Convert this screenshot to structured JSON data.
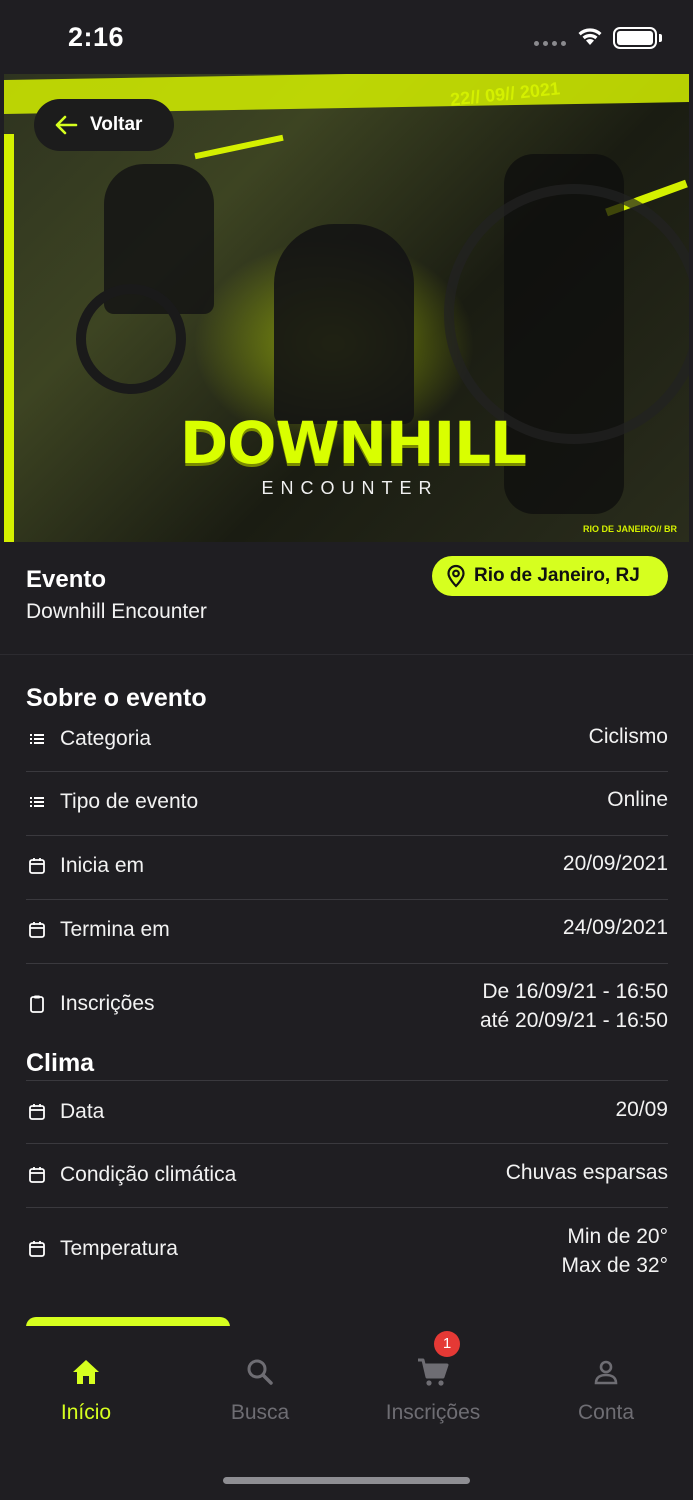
{
  "status_bar": {
    "time": "2:16"
  },
  "banner": {
    "back_label": "Voltar",
    "art_date": "22// 09// 2021",
    "art_title": "DOWNHILL",
    "art_subtitle": "ENCOUNTER",
    "art_location": "RIO DE JANEIRO// BR"
  },
  "event": {
    "heading": "Evento",
    "name": "Downhill Encounter",
    "location": "Rio de Janeiro, RJ"
  },
  "about": {
    "title": "Sobre o evento",
    "rows": [
      {
        "label": "Categoria",
        "icon": "list-icon",
        "value": "Ciclismo"
      },
      {
        "label": "Tipo de evento",
        "icon": "list-icon",
        "value": "Online"
      },
      {
        "label": "Inicia em",
        "icon": "calendar-icon",
        "value": "20/09/2021"
      },
      {
        "label": "Termina em",
        "icon": "calendar-icon",
        "value": "24/09/2021"
      },
      {
        "label": "Inscrições",
        "icon": "clipboard-icon",
        "value_line1": "De 16/09/21 - 16:50",
        "value_line2": "até 20/09/21 - 16:50"
      }
    ]
  },
  "weather": {
    "title": "Clima",
    "rows": [
      {
        "label": "Data",
        "icon": "calendar-icon",
        "value": "20/09"
      },
      {
        "label": "Condição climática",
        "icon": "calendar-icon",
        "value": "Chuvas esparsas"
      },
      {
        "label": "Temperatura",
        "icon": "calendar-icon",
        "value_line1": "Min de 20°",
        "value_line2": "Max de 32°"
      }
    ]
  },
  "tabbar": {
    "tabs": [
      {
        "label": "Início",
        "icon": "home-icon",
        "active": true
      },
      {
        "label": "Busca",
        "icon": "search-icon",
        "active": false
      },
      {
        "label": "Inscrições",
        "icon": "cart-icon",
        "active": false,
        "badge": "1"
      },
      {
        "label": "Conta",
        "icon": "person-icon",
        "active": false
      }
    ]
  },
  "colors": {
    "accent": "#d6ff1f",
    "background": "#1f1e22",
    "badge": "#e53935",
    "inactive": "#6e6d73"
  }
}
